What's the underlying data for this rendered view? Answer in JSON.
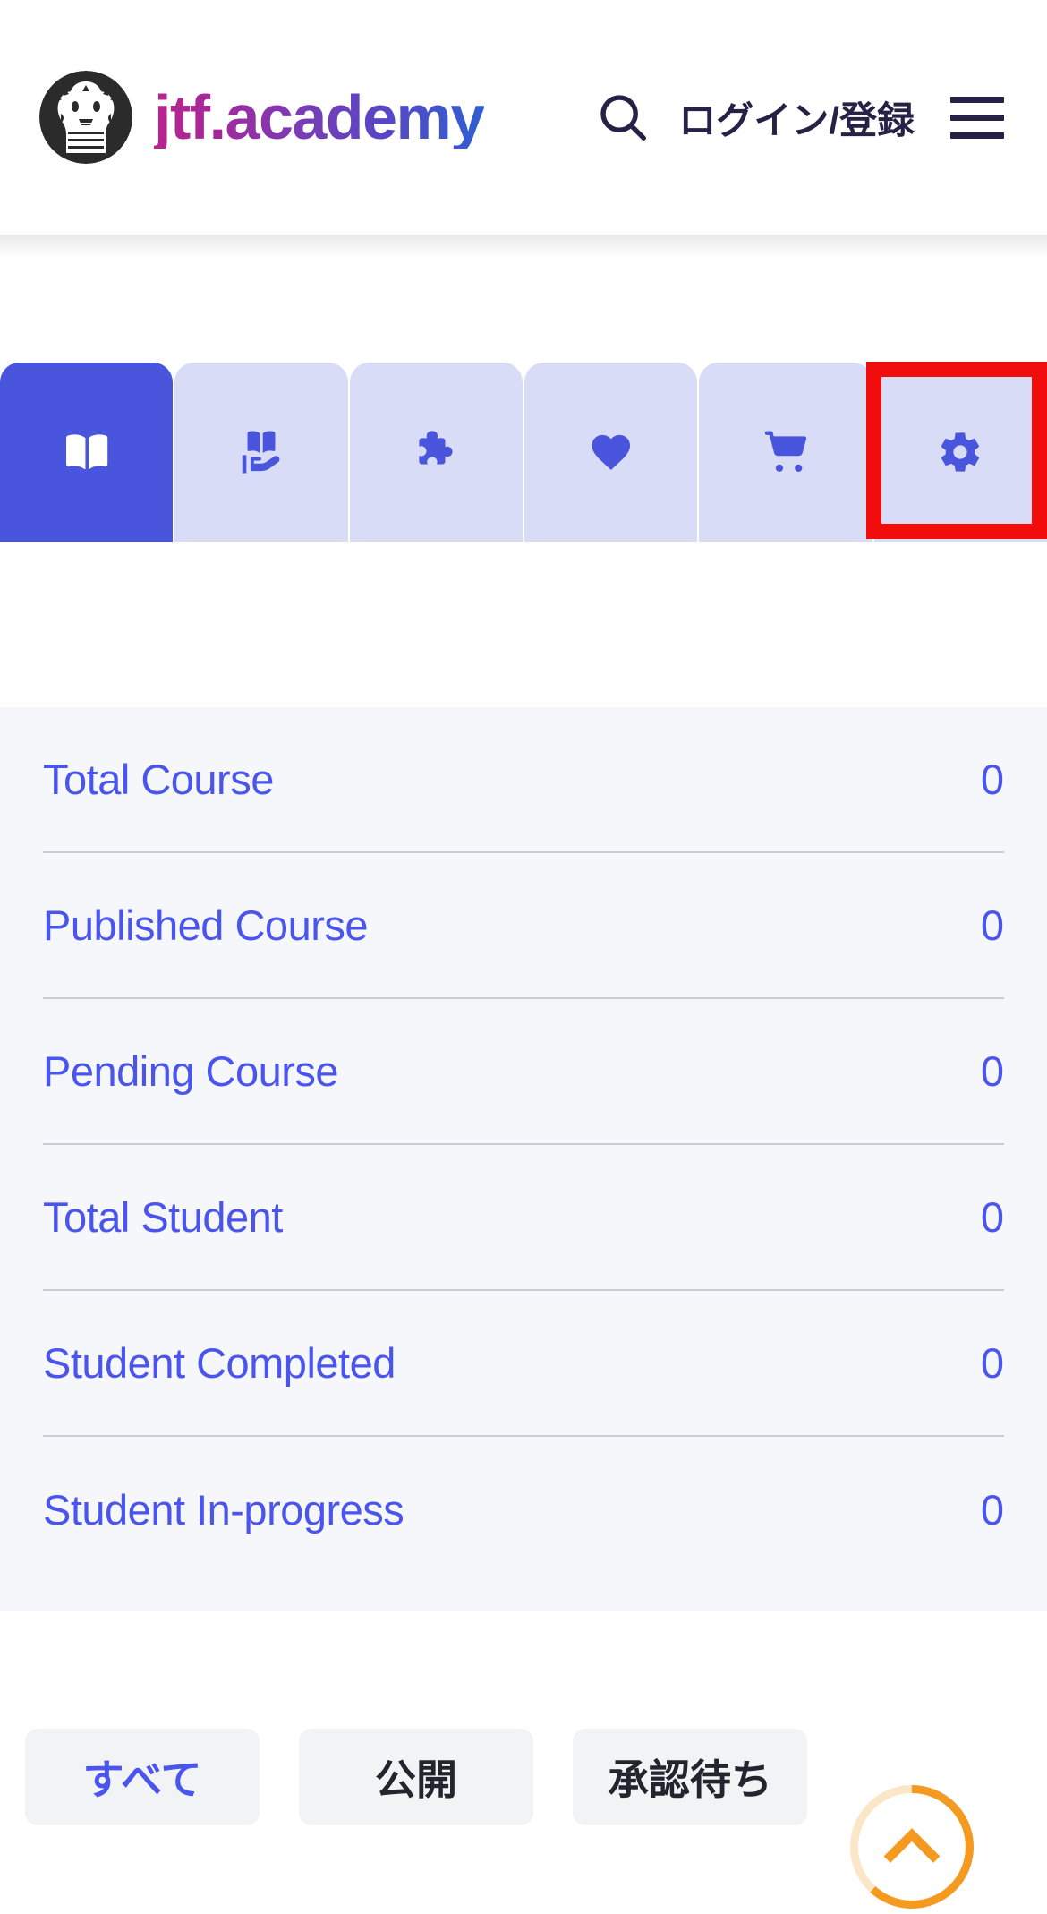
{
  "header": {
    "logo_icon": "academy-crest-emblem",
    "brand_text": "jtf.academy",
    "brand_part_1": "jtf",
    "brand_dot": ".",
    "brand_part_2": "academy",
    "search_icon": "search-icon",
    "login_label": "ログイン/登録",
    "menu_icon": "hamburger-menu-icon",
    "brand_gradient_from": "#b5268c",
    "brand_gradient_to": "#2f5fd0",
    "text_color": "#262145"
  },
  "tabbar": {
    "active_index": 0,
    "active_bg": "#4a55dd",
    "inactive_bg": "#d8dcf6",
    "icon_color": "#4a55dd",
    "tabs": [
      {
        "icon": "open-book-icon",
        "name": "courses",
        "active": true
      },
      {
        "icon": "hand-holding-book-icon",
        "name": "my-learning",
        "active": false
      },
      {
        "icon": "puzzle-piece-icon",
        "name": "quiz",
        "active": false
      },
      {
        "icon": "heart-icon",
        "name": "wishlist",
        "active": false
      },
      {
        "icon": "shopping-cart-icon",
        "name": "cart",
        "active": false
      },
      {
        "icon": "gear-icon",
        "name": "settings",
        "active": false
      }
    ]
  },
  "annotation": {
    "target": "settings-tab",
    "color": "#f20d0d",
    "shape": "rectangle-outline"
  },
  "stats": {
    "background": "#f6f7fa",
    "text_color": "#4a55ee",
    "rows": [
      {
        "label": "Total Course",
        "value": "0"
      },
      {
        "label": "Published Course",
        "value": "0"
      },
      {
        "label": "Pending Course",
        "value": "0"
      },
      {
        "label": "Total Student",
        "value": "0"
      },
      {
        "label": "Student Completed",
        "value": "0"
      },
      {
        "label": "Student In-progress",
        "value": "0"
      }
    ]
  },
  "filters": {
    "chips": [
      {
        "label": "すべて",
        "selected": true
      },
      {
        "label": "公開",
        "selected": false
      },
      {
        "label": "承認待ち",
        "selected": false
      }
    ],
    "chip_bg": "#f2f3f5",
    "selected_color": "#4a55ee",
    "default_color": "#23252e"
  },
  "scroll_top": {
    "icon": "chevron-up-icon",
    "ring_color": "#f59a20",
    "track_color": "#fbe6c8",
    "progress_percent": 62
  }
}
